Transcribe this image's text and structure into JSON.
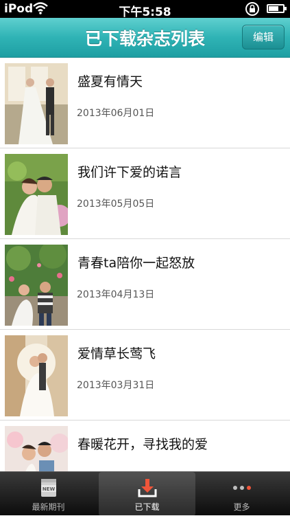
{
  "status": {
    "carrier": "iPod",
    "time": "下午5:58",
    "battery_level": 0.7
  },
  "nav": {
    "title": "已下载杂志列表",
    "edit_label": "编辑"
  },
  "magazines": [
    {
      "title": "盛夏有情天",
      "date": "2013年06月01日"
    },
    {
      "title": "我们许下爱的诺言",
      "date": "2013年05月05日"
    },
    {
      "title": "青春ta陪你一起怒放",
      "date": "2013年04月13日"
    },
    {
      "title": "爱情草长莺飞",
      "date": "2013年03月31日"
    },
    {
      "title": "春暖花开，寻找我的爱",
      "date": ""
    }
  ],
  "tabs": [
    {
      "label": "最新期刊",
      "icon": "new-issue-icon",
      "badge": "NEW"
    },
    {
      "label": "已下载",
      "icon": "download-icon"
    },
    {
      "label": "更多",
      "icon": "more-dots-icon"
    }
  ],
  "colors": {
    "accent": "#2fb3b5",
    "download_icon": "#f0553a"
  }
}
